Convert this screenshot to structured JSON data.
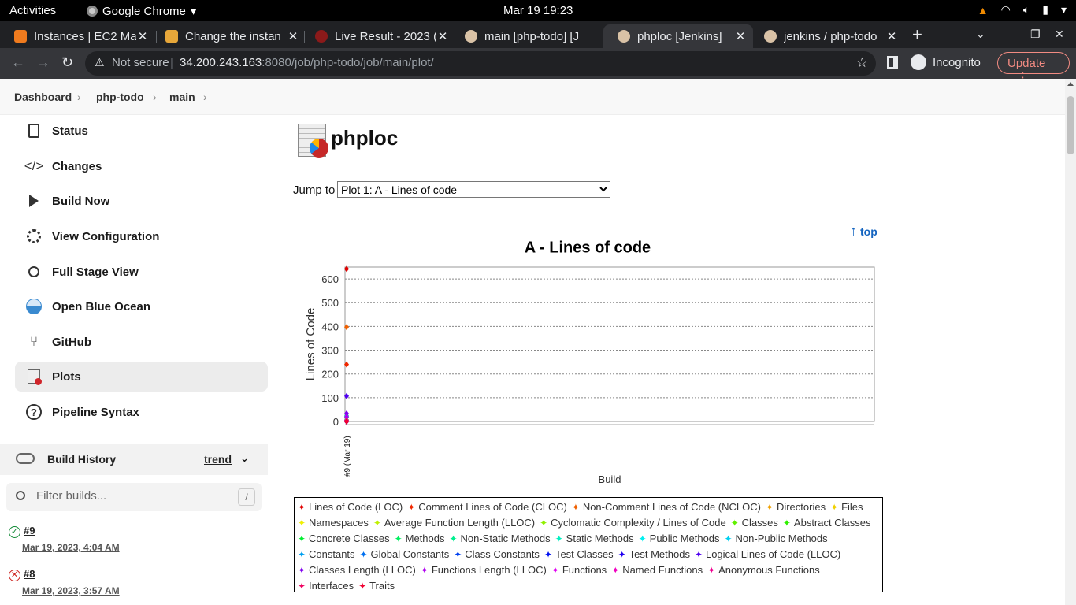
{
  "system": {
    "activities": "Activities",
    "app_name": "Google Chrome",
    "clock": "Mar 19  19:23"
  },
  "tabs": [
    {
      "title": "Instances | EC2 Ma",
      "icon_color": "#f07b1e",
      "active": false
    },
    {
      "title": "Change the instan",
      "icon_color": "#e7a73a",
      "active": false
    },
    {
      "title": "Live Result - 2023 (",
      "icon_color": "#8b1a1a",
      "active": false
    },
    {
      "title": "main [php-todo] [J",
      "icon_color": "#d9c2a6",
      "active": false
    },
    {
      "title": "phploc [Jenkins]",
      "icon_color": "#d9c2a6",
      "active": true
    },
    {
      "title": "jenkins / php-todo",
      "icon_color": "#d9c2a6",
      "active": false
    }
  ],
  "address_bar": {
    "security": "Not secure",
    "host": "34.200.243.163",
    "rest": ":8080/job/php-todo/job/main/plot/",
    "incognito": "Incognito",
    "update": "Update"
  },
  "breadcrumb": [
    "Dashboard",
    "php-todo",
    "main"
  ],
  "sidebar": {
    "tasks": [
      {
        "label": "Status",
        "icon": "status-icon"
      },
      {
        "label": "Changes",
        "icon": "code-icon"
      },
      {
        "label": "Build Now",
        "icon": "play-icon"
      },
      {
        "label": "View Configuration",
        "icon": "gear-icon"
      },
      {
        "label": "Full Stage View",
        "icon": "search-icon"
      },
      {
        "label": "Open Blue Ocean",
        "icon": "blue-ocean-icon"
      },
      {
        "label": "GitHub",
        "icon": "git-branch-icon"
      },
      {
        "label": "Plots",
        "icon": "plots-icon",
        "active": true
      },
      {
        "label": "Pipeline Syntax",
        "icon": "help-icon"
      }
    ],
    "build_history": {
      "title": "Build History",
      "trend": "trend",
      "filter_placeholder": "Filter builds...",
      "shortcut": "/",
      "builds": [
        {
          "number": "#9",
          "date": "Mar 19, 2023, 4:04 AM",
          "status": "success"
        },
        {
          "number": "#8",
          "date": "Mar 19, 2023, 3:57 AM",
          "status": "failed"
        }
      ]
    }
  },
  "main": {
    "title": "phploc",
    "jump_label": "Jump to",
    "jump_selected": "Plot 1: A - Lines of code",
    "top_link": "top"
  },
  "chart_data": {
    "type": "line",
    "title": "A - Lines of code",
    "xlabel": "Build",
    "ylabel": "Lines of Code",
    "categories": [
      "#9 (Mar 19)"
    ],
    "ylim": [
      0,
      650
    ],
    "yticks": [
      0,
      100,
      200,
      300,
      400,
      500,
      600
    ],
    "grid": true,
    "legend_position": "bottom",
    "series": [
      {
        "name": "Lines of Code (LOC)",
        "color": "#e00000",
        "values": [
          642
        ]
      },
      {
        "name": "Comment Lines of Code (CLOC)",
        "color": "#f02800",
        "values": [
          240
        ]
      },
      {
        "name": "Non-Comment Lines of Code (NCLOC)",
        "color": "#f06000",
        "values": [
          397
        ]
      },
      {
        "name": "Directories",
        "color": "#f0a000",
        "values": [
          5
        ]
      },
      {
        "name": "Files",
        "color": "#f0d000",
        "values": [
          7
        ]
      },
      {
        "name": "Namespaces",
        "color": "#f0f000",
        "values": [
          0
        ]
      },
      {
        "name": "Average Function Length (LLOC)",
        "color": "#c0f000",
        "values": [
          3
        ]
      },
      {
        "name": "Cyclomatic Complexity / Lines of Code",
        "color": "#90f000",
        "values": [
          0.1
        ]
      },
      {
        "name": "Classes",
        "color": "#60f000",
        "values": [
          6
        ]
      },
      {
        "name": "Abstract Classes",
        "color": "#30f000",
        "values": [
          0
        ]
      },
      {
        "name": "Concrete Classes",
        "color": "#00f030",
        "values": [
          6
        ]
      },
      {
        "name": "Methods",
        "color": "#00f060",
        "values": [
          24
        ]
      },
      {
        "name": "Non-Static Methods",
        "color": "#00f090",
        "values": [
          18
        ]
      },
      {
        "name": "Static Methods",
        "color": "#00f0c0",
        "values": [
          6
        ]
      },
      {
        "name": "Public Methods",
        "color": "#00f0f0",
        "values": [
          22
        ]
      },
      {
        "name": "Non-Public Methods",
        "color": "#00d0f0",
        "values": [
          2
        ]
      },
      {
        "name": "Constants",
        "color": "#00a0f0",
        "values": [
          0
        ]
      },
      {
        "name": "Global Constants",
        "color": "#0070f0",
        "values": [
          0
        ]
      },
      {
        "name": "Class Constants",
        "color": "#0040f0",
        "values": [
          0
        ]
      },
      {
        "name": "Test Classes",
        "color": "#0010f0",
        "values": [
          0
        ]
      },
      {
        "name": "Test Methods",
        "color": "#2000f0",
        "values": [
          0
        ]
      },
      {
        "name": "Logical Lines of Code (LLOC)",
        "color": "#5000f0",
        "values": [
          107
        ]
      },
      {
        "name": "Classes Length (LLOC)",
        "color": "#8000f0",
        "values": [
          33
        ]
      },
      {
        "name": "Functions Length (LLOC)",
        "color": "#b000f0",
        "values": [
          20
        ]
      },
      {
        "name": "Functions",
        "color": "#e000f0",
        "values": [
          4
        ]
      },
      {
        "name": "Named Functions",
        "color": "#f000c0",
        "values": [
          0
        ]
      },
      {
        "name": "Anonymous Functions",
        "color": "#f00090",
        "values": [
          4
        ]
      },
      {
        "name": "Interfaces",
        "color": "#f00060",
        "values": [
          0
        ]
      },
      {
        "name": "Traits",
        "color": "#f00030",
        "values": [
          0
        ]
      }
    ]
  }
}
